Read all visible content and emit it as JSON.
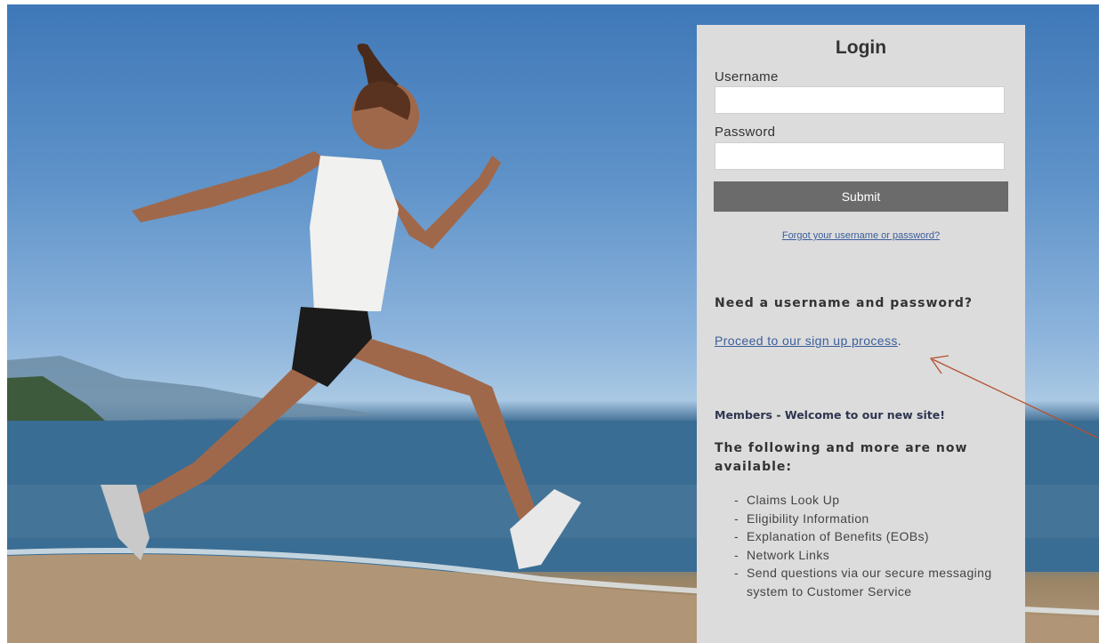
{
  "login": {
    "title": "Login",
    "username_label": "Username",
    "username_value": "",
    "password_label": "Password",
    "password_value": "",
    "submit_label": "Submit",
    "forgot_link": "Forgot your username or password?"
  },
  "signup": {
    "heading": "Need a username and password?",
    "link_text": "Proceed to our sign up process",
    "link_suffix": "."
  },
  "members": {
    "welcome": "Members - Welcome to our new site!",
    "heading": "The following and more are now available:",
    "features": [
      "Claims Look Up",
      "Eligibility Information",
      "Explanation of Benefits (EOBs)",
      "Network Links",
      "Send questions via our secure messaging system to Customer Service"
    ]
  },
  "colors": {
    "panel_bg": "#dcdcdc",
    "submit_bg": "#6b6b6b",
    "link": "#3b5e9b",
    "annotation_arrow": "#b4502e"
  },
  "hero": {
    "image": "woman-running-on-beach-photo"
  }
}
